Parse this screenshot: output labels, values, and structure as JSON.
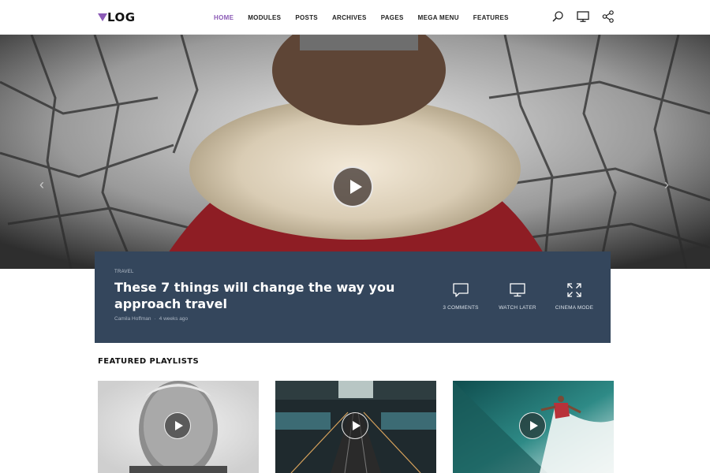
{
  "brand": {
    "logo_text": "LOG",
    "accent": "#8b5ab6"
  },
  "nav": {
    "items": [
      {
        "label": "HOME",
        "active": true
      },
      {
        "label": "MODULES",
        "active": false
      },
      {
        "label": "POSTS",
        "active": false
      },
      {
        "label": "ARCHIVES",
        "active": false
      },
      {
        "label": "PAGES",
        "active": false
      },
      {
        "label": "MEGA MENU",
        "active": false
      },
      {
        "label": "FEATURES",
        "active": false
      }
    ],
    "icons": [
      "search-icon",
      "monitor-icon",
      "share-icon"
    ]
  },
  "hero": {
    "category": "TRAVEL",
    "title": "These 7 things will change the way you approach travel",
    "author": "Camila Hoffman",
    "separator": "·",
    "date": "4 weeks ago",
    "actions": [
      {
        "icon": "comment-icon",
        "label": "3 COMMENTS"
      },
      {
        "icon": "monitor-icon",
        "label": "WATCH LATER"
      },
      {
        "icon": "expand-icon",
        "label": "CINEMA MODE"
      }
    ],
    "card_color": "#34465c"
  },
  "featured": {
    "title": "FEATURED PLAYLISTS",
    "items": [
      {
        "name": "portrait-thumbnail"
      },
      {
        "name": "escalator-thumbnail"
      },
      {
        "name": "surfer-thumbnail"
      }
    ]
  }
}
